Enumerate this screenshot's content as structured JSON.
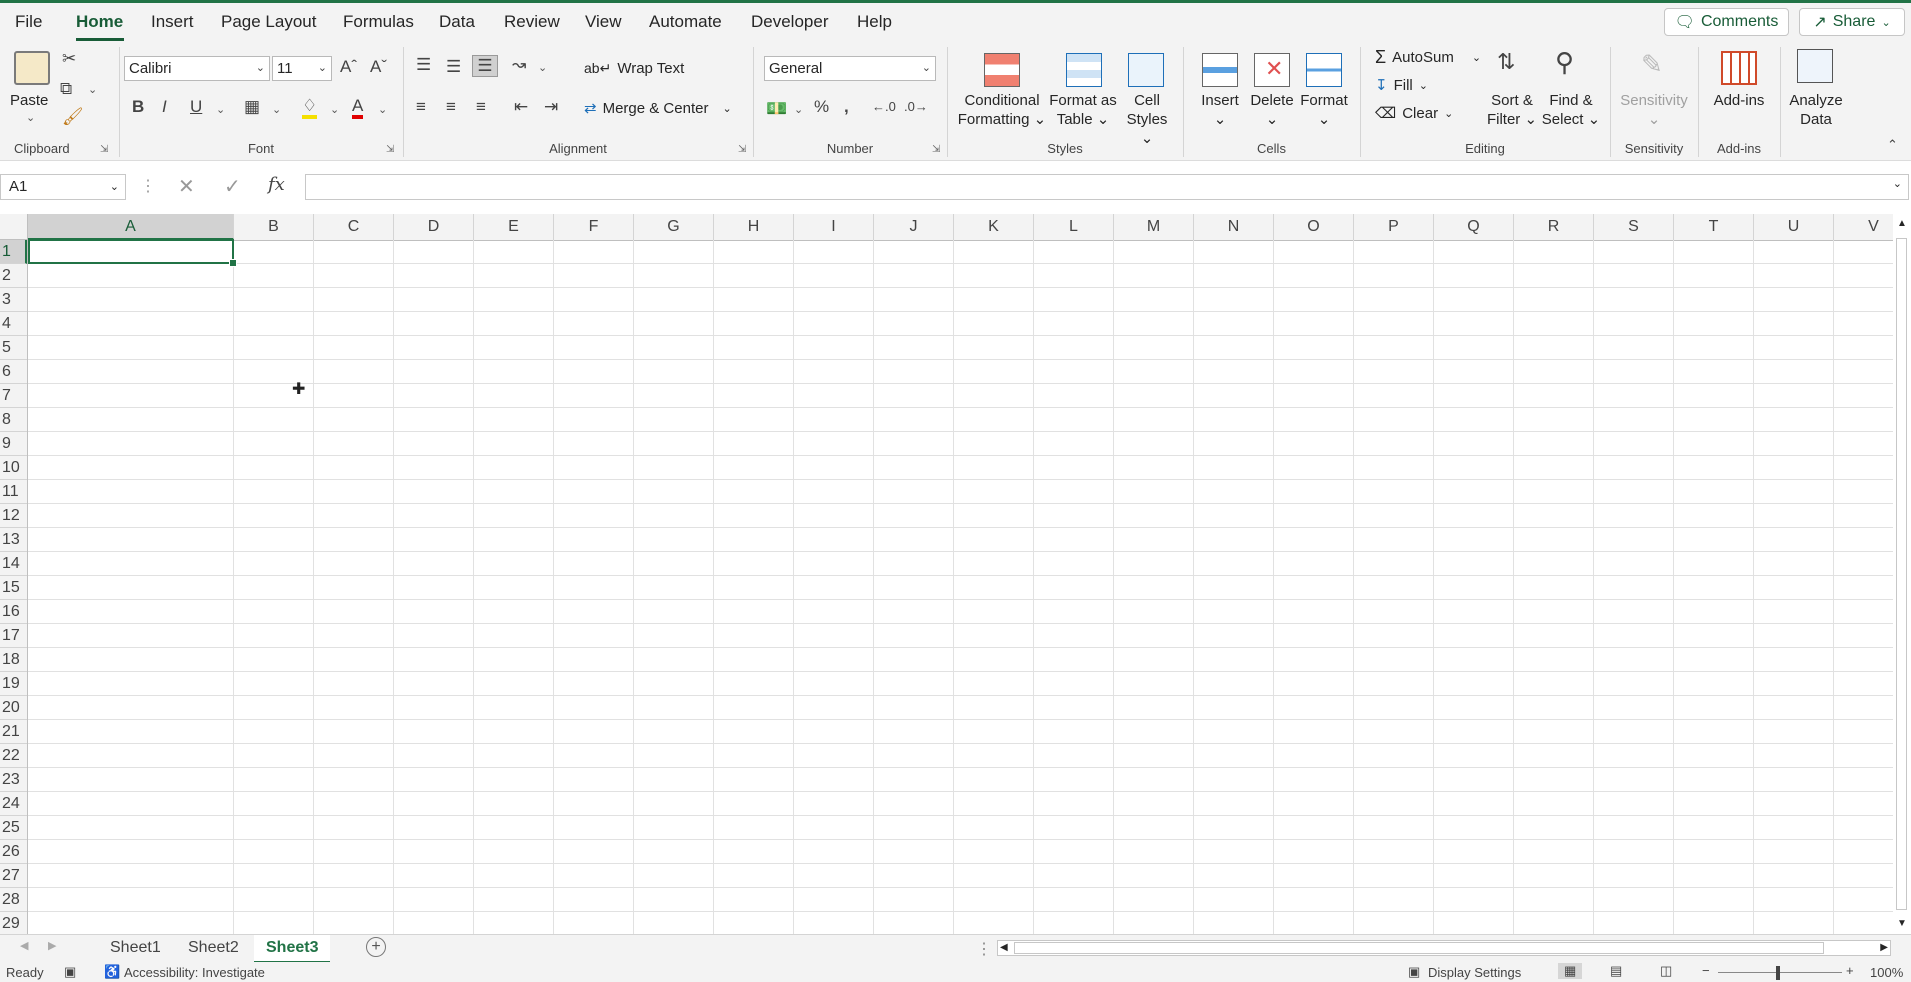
{
  "menu": {
    "tabs": [
      "File",
      "Home",
      "Insert",
      "Page Layout",
      "Formulas",
      "Data",
      "Review",
      "View",
      "Automate",
      "Developer",
      "Help"
    ],
    "comments_label": "Comments",
    "share_label": "Share"
  },
  "ribbon": {
    "clipboard": {
      "paste_label": "Paste",
      "group_label": "Clipboard"
    },
    "font": {
      "font_name": "Calibri",
      "font_size": "11",
      "group_label": "Font",
      "bold": "B",
      "italic": "I",
      "underline": "U"
    },
    "alignment": {
      "wrap_text": "Wrap Text",
      "merge_center": "Merge & Center",
      "group_label": "Alignment"
    },
    "number": {
      "format": "General",
      "group_label": "Number"
    },
    "styles": {
      "conditional_1": "Conditional",
      "conditional_2": "Formatting",
      "format_table_1": "Format as",
      "format_table_2": "Table",
      "cell_styles_1": "Cell",
      "cell_styles_2": "Styles",
      "group_label": "Styles"
    },
    "cells": {
      "insert": "Insert",
      "delete": "Delete",
      "format": "Format",
      "group_label": "Cells"
    },
    "editing": {
      "autosum": "AutoSum",
      "fill": "Fill",
      "clear": "Clear",
      "sort_1": "Sort &",
      "sort_2": "Filter",
      "find_1": "Find &",
      "find_2": "Select",
      "group_label": "Editing"
    },
    "sensitivity": {
      "label": "Sensitivity",
      "group_label": "Sensitivity"
    },
    "addins": {
      "label": "Add-ins",
      "group_label": "Add-ins"
    },
    "analyze": {
      "label_1": "Analyze",
      "label_2": "Data"
    }
  },
  "formula_bar": {
    "name_box": "A1",
    "fx": "fx",
    "value": ""
  },
  "grid": {
    "columns": [
      "A",
      "B",
      "C",
      "D",
      "E",
      "F",
      "G",
      "H",
      "I",
      "J",
      "K",
      "L",
      "M",
      "N",
      "O",
      "P",
      "Q",
      "R",
      "S",
      "T",
      "U",
      "V"
    ],
    "rows": [
      "1",
      "2",
      "3",
      "4",
      "5",
      "6",
      "7",
      "8",
      "9",
      "10",
      "11",
      "12",
      "13",
      "14",
      "15",
      "16",
      "17",
      "18",
      "19",
      "20",
      "21",
      "22",
      "23",
      "24",
      "25",
      "26",
      "27",
      "28",
      "29"
    ],
    "active_cell": "A1"
  },
  "sheets": {
    "tabs": [
      "Sheet1",
      "Sheet2",
      "Sheet3"
    ],
    "active": "Sheet3"
  },
  "status": {
    "ready": "Ready",
    "accessibility": "Accessibility: Investigate",
    "display_settings": "Display Settings",
    "zoom": "100%"
  },
  "colors": {
    "accent": "#217346",
    "accent_dark": "#185c37"
  }
}
